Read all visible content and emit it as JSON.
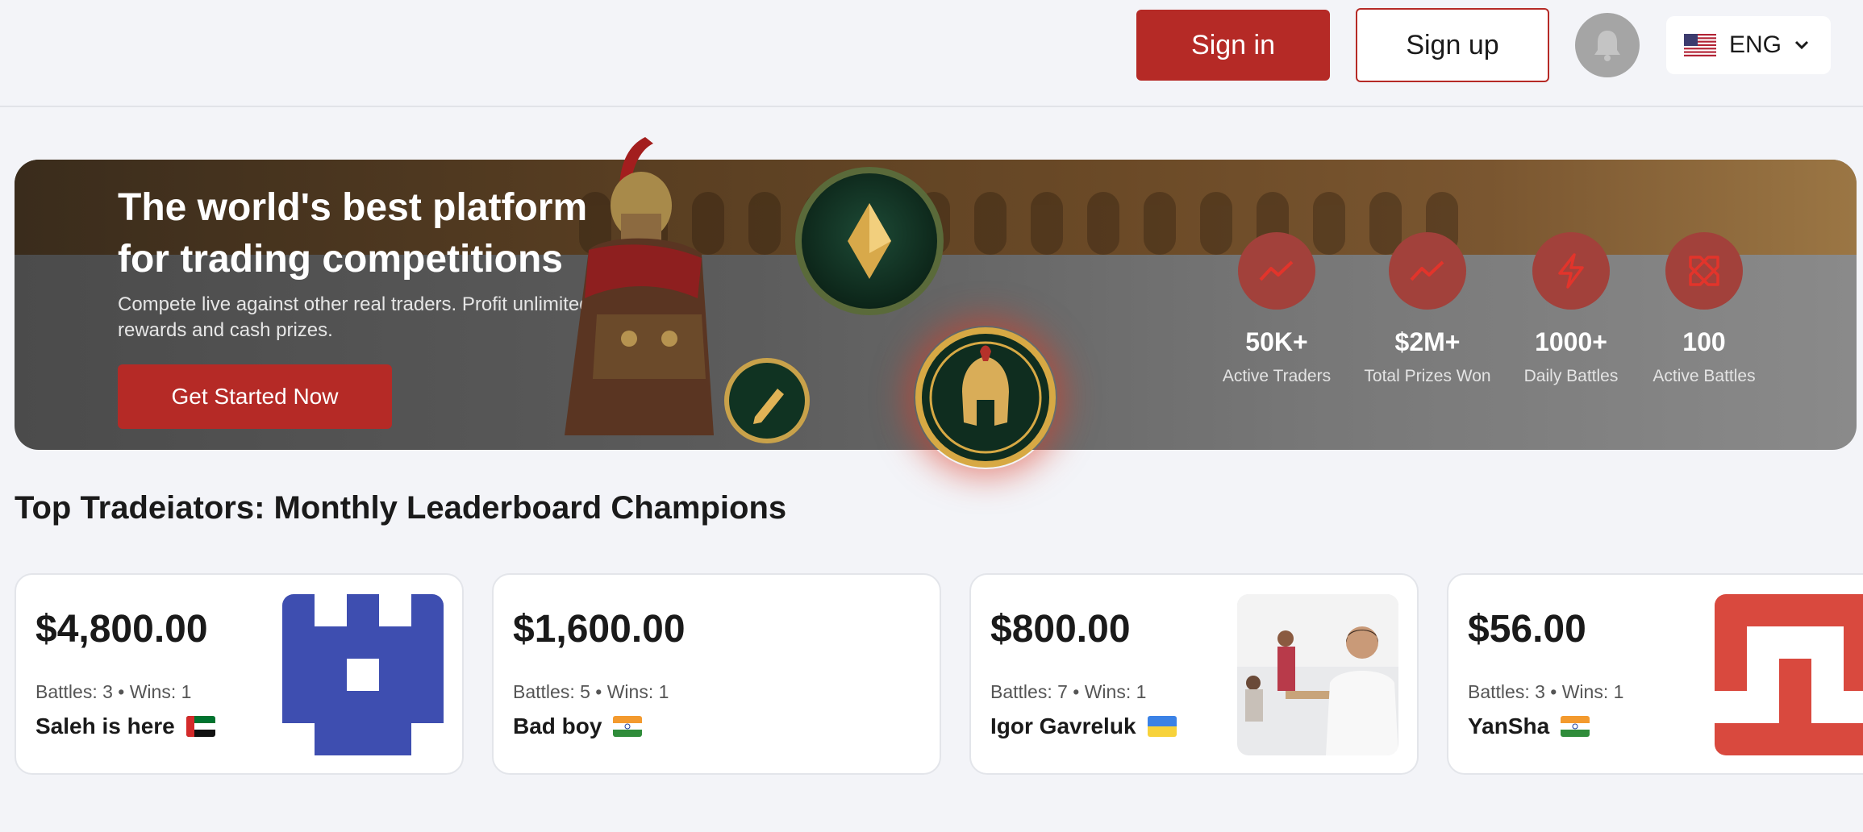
{
  "header": {
    "signin_label": "Sign in",
    "signup_label": "Sign up",
    "bell_icon": "bell-icon",
    "language": {
      "code": "ENG",
      "flag": "us-flag-icon",
      "chevron": "chevron-down-icon"
    }
  },
  "hero": {
    "title_line1": "The world's best platform",
    "title_line2": "for trading competitions",
    "subtitle": "Compete live against other real traders. Profit unlimited rewards and cash prizes.",
    "cta_label": "Get Started Now",
    "stats": [
      {
        "value": "50K+",
        "label": "Active Traders",
        "icon": "trending-up-icon"
      },
      {
        "value": "$2M+",
        "label": "Total Prizes Won",
        "icon": "trending-up-icon"
      },
      {
        "value": "1000+",
        "label": "Daily Battles",
        "icon": "lightning-icon"
      },
      {
        "value": "100",
        "label": "Active Battles",
        "icon": "swords-icon"
      }
    ]
  },
  "leaderboard": {
    "title": "Top Tradeiators: Monthly Leaderboard Champions",
    "cards": [
      {
        "amount": "$4,800.00",
        "battles": "Battles: 3 • Wins: 1",
        "name": "Saleh is here",
        "flag": "uae-flag-icon"
      },
      {
        "amount": "$1,600.00",
        "battles": "Battles: 5 • Wins: 1",
        "name": "Bad boy",
        "flag": "india-flag-icon"
      },
      {
        "amount": "$800.00",
        "battles": "Battles: 7 • Wins: 1",
        "name": "Igor Gavreluk",
        "flag": "ukraine-flag-icon"
      },
      {
        "amount": "$56.00",
        "battles": "Battles: 3 • Wins: 1",
        "name": "YanSha",
        "flag": "india-flag-icon"
      }
    ]
  },
  "colors": {
    "brand_red": "#b52a26",
    "stat_circle": "#a2413b",
    "page_bg": "#f3f4f8"
  }
}
